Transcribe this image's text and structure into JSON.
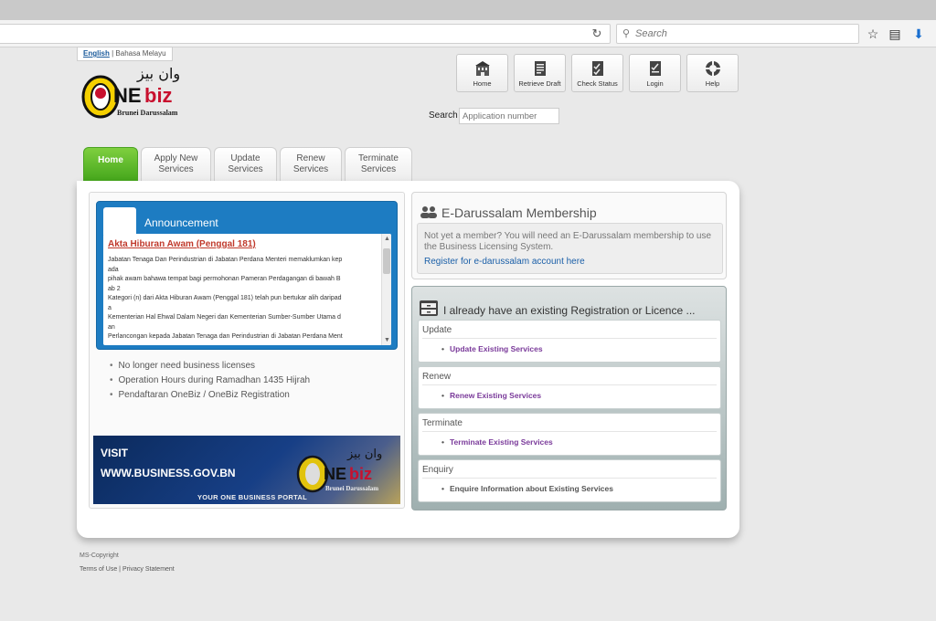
{
  "browser": {
    "search_placeholder": "Search"
  },
  "language": {
    "english": "English",
    "separator": " | ",
    "malay": "Bahasa Melayu"
  },
  "logo": {
    "main_text": "ONEbiz",
    "sub_text": "Brunei Darussalam",
    "arabic_text": "وان بيز"
  },
  "top_nav": [
    {
      "label": "Home",
      "icon": "building-icon"
    },
    {
      "label": "Retrieve Draft",
      "icon": "document-icon"
    },
    {
      "label": "Check Status",
      "icon": "checklist-icon"
    },
    {
      "label": "Login",
      "icon": "login-icon"
    },
    {
      "label": "Help",
      "icon": "lifebuoy-icon"
    }
  ],
  "search": {
    "label": "Search",
    "placeholder": "Application number"
  },
  "tabs": [
    {
      "line1": "Home",
      "line2": "",
      "active": true
    },
    {
      "line1": "Apply New",
      "line2": "Services",
      "active": false
    },
    {
      "line1": "Update",
      "line2": "Services",
      "active": false
    },
    {
      "line1": "Renew",
      "line2": "Services",
      "active": false
    },
    {
      "line1": "Terminate",
      "line2": "Services",
      "active": false
    }
  ],
  "announcement": {
    "title": "Announcement",
    "headline": "Akta Hiburan Awam (Penggal 181)",
    "lines": [
      "Jabatan Tenaga Dan Perindustrian di Jabatan Perdana Menteri memaklumkan kep",
      "ada",
      "pihak awam bahawa tempat bagi permohonan Pameran Perdagangan di bawah B",
      "ab 2",
      "Kategori (n) dari Akta Hiburan Awam (Penggal 181) telah pun bertukar alih daripad",
      "a",
      "Kementerian Hal Ehwal Dalam Negeri dan Kementerian Sumber-Sumber Utama d",
      "an",
      "Perlancongan kepada Jabatan Tenaga dan Perindustrian di Jabatan Perdana Ment"
    ]
  },
  "news_items": [
    "No longer need business licenses",
    "Operation Hours during Ramadhan 1435 Hijrah",
    "Pendaftaran OneBiz / OneBiz Registration"
  ],
  "banner": {
    "visit": "VISIT",
    "url": "WWW.BUSINESS.GOV.BN",
    "tagline": "YOUR ONE BUSINESS PORTAL"
  },
  "membership": {
    "title": "E-Darussalam Membership",
    "description": "Not yet a member? You will need an E-Darussalam membership to use the Business Licensing System.",
    "register_link": "Register for e-darussalam account here"
  },
  "registration": {
    "title": "I already have an existing Registration or Licence ...",
    "cards": [
      {
        "title": "Update",
        "link": "Update Existing Services",
        "style": "link"
      },
      {
        "title": "Renew",
        "link": "Renew Existing Services",
        "style": "link"
      },
      {
        "title": "Terminate",
        "link": "Terminate Existing Services",
        "style": "link"
      },
      {
        "title": "Enquiry",
        "link": "Enquire Information about Existing Services",
        "style": "plain"
      }
    ]
  },
  "footer": {
    "copyright": "MS-Copyright",
    "terms": "Terms of Use",
    "separator": " | ",
    "privacy": "Privacy Statement"
  },
  "colors": {
    "active_tab": "#43a51b",
    "announcement_blue": "#1d7cc2",
    "headline_red": "#c0392b",
    "service_link_purple": "#7a3a9a"
  }
}
